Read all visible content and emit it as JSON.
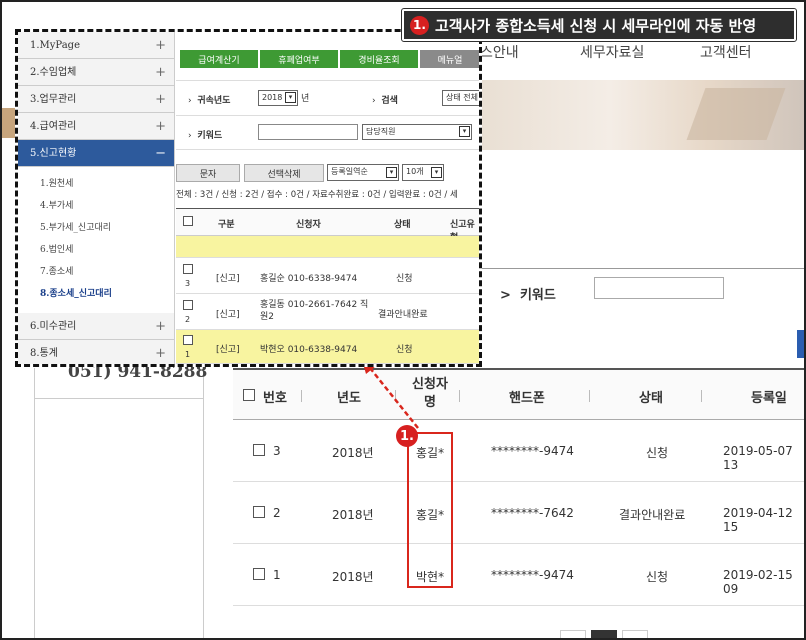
{
  "callout": {
    "badge": "1.",
    "text": "고객사가 종합소득세 신청 시 세무라인에 자동 반영"
  },
  "badge2": "1.",
  "background": {
    "nav": [
      "스안내",
      "세무자료실",
      "고객센터"
    ],
    "keyword_label": "키워드",
    "phone": "051) 941-8288"
  },
  "big_table": {
    "headers": {
      "check": "",
      "no": "번호",
      "year": "년도",
      "applicant": "신청자명",
      "phone": "핸드폰",
      "status": "상태",
      "date": "등록일"
    },
    "rows": [
      {
        "no": "3",
        "year": "2018년",
        "applicant": "홍길*",
        "phone": "********-9474",
        "status": "신청",
        "date": "2019-05-07 13"
      },
      {
        "no": "2",
        "year": "2018년",
        "applicant": "홍길*",
        "phone": "********-7642",
        "status": "결과안내완료",
        "date": "2019-04-12 15"
      },
      {
        "no": "1",
        "year": "2018년",
        "applicant": "박현*",
        "phone": "********-9474",
        "status": "신청",
        "date": "2019-02-15 09"
      }
    ]
  },
  "popup": {
    "menu": [
      {
        "label": "1.MyPage",
        "sign": "+"
      },
      {
        "label": "2.수임업체",
        "sign": "+"
      },
      {
        "label": "3.업무관리",
        "sign": "+"
      },
      {
        "label": "4.급여관리",
        "sign": "+"
      },
      {
        "label": "5.신고현황",
        "sign": "−"
      }
    ],
    "submenu": [
      "1.원천세",
      "4.부가세",
      "5.부가세_신고대리",
      "6.법인세",
      "7.종소세",
      "8.종소세_신고대리"
    ],
    "menu_bottom": [
      {
        "label": "6.미수관리",
        "sign": "+"
      },
      {
        "label": "8.통계",
        "sign": "+"
      }
    ],
    "tabs": [
      "급여계산기",
      "휴폐업여부",
      "경비율조회",
      "메뉴얼"
    ],
    "year_label": "귀속년도",
    "year_value": "2018",
    "year_suffix": "년",
    "search_label": "검색",
    "search_select": "상태 전체",
    "keyword_label": "키워드",
    "keyword_select": "담당직원",
    "btn_sms": "문자",
    "btn_delete": "선택삭제",
    "sort_select": "등록일역순",
    "count_select": "10개",
    "summary": "전체 : 3건 / 신청 : 2건 / 접수 : 0건 / 자료수취완료 : 0건 / 입력완료 : 0건 / 세",
    "headers": [
      "구분",
      "신청자",
      "상태",
      "신고유형"
    ],
    "rows": [
      {
        "no": "3",
        "type": "[신고]",
        "applicant": "홍길순 010-6338-9474",
        "status": "신청"
      },
      {
        "no": "2",
        "type": "[신고]",
        "applicant": "홍길동 010-2661-7642 직원2",
        "status": "결과안내완료"
      },
      {
        "no": "1",
        "type": "[신고]",
        "applicant": "박현오 010-6338-9474",
        "status": "신청"
      }
    ]
  }
}
